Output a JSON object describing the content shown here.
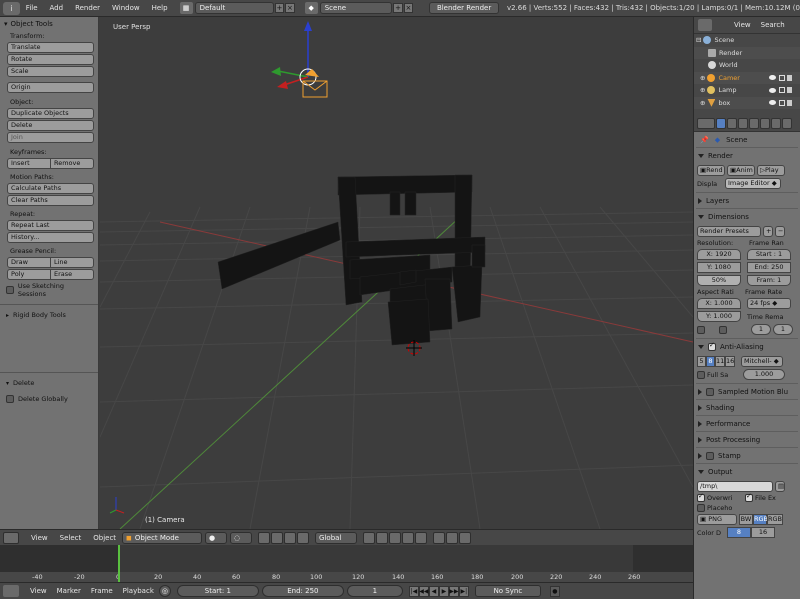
{
  "topbar": {
    "menus": [
      "File",
      "Add",
      "Render",
      "Window",
      "Help"
    ],
    "layout": "Default",
    "scene": "Scene",
    "engine": "Blender Render",
    "stats": "v2.66 | Verts:552 | Faces:432 | Tris:432 | Objects:1/20 | Lamps:0/1 | Mem:10.12M (0"
  },
  "toolshelf": {
    "title": "Object Tools",
    "transform_label": "Transform:",
    "translate": "Translate",
    "rotate": "Rotate",
    "scale": "Scale",
    "origin": "Origin",
    "object_label": "Object:",
    "duplicate": "Duplicate Objects",
    "delete": "Delete",
    "join": "Join",
    "keyframes_label": "Keyframes:",
    "insert": "Insert",
    "remove": "Remove",
    "motion_label": "Motion Paths:",
    "calc_paths": "Calculate Paths",
    "clear_paths": "Clear Paths",
    "repeat_label": "Repeat:",
    "repeat_last": "Repeat Last",
    "history": "History...",
    "grease_label": "Grease Pencil:",
    "draw": "Draw",
    "line": "Line",
    "poly": "Poly",
    "erase": "Erase",
    "sketching": "Use Sketching Sessions",
    "rigid": "Rigid Body Tools",
    "op_title": "Delete",
    "delete_globally": "Delete Globally"
  },
  "viewport": {
    "label": "User Persp",
    "object": "(1) Camera"
  },
  "viewheader": {
    "menus": [
      "View",
      "Select",
      "Object"
    ],
    "mode": "Object Mode",
    "orientation": "Global"
  },
  "timeline": {
    "ruler": [
      "-40",
      "-20",
      "0",
      "20",
      "40",
      "60",
      "80",
      "100",
      "120",
      "140",
      "160",
      "180",
      "200",
      "220",
      "240",
      "260"
    ],
    "menus": [
      "View",
      "Marker",
      "Frame",
      "Playback"
    ],
    "start": "Start: 1",
    "end": "End: 250",
    "current": "1",
    "sync": "No Sync"
  },
  "outliner": {
    "menus": [
      "View",
      "Search"
    ],
    "rows": [
      "Scene",
      "Render",
      "World",
      "Camer",
      "Lamp",
      "box"
    ]
  },
  "properties": {
    "crumb": "Scene",
    "render_panel": "Render",
    "render_btn": "Rend",
    "anim_btn": "Anim",
    "play_btn": "Play",
    "display_label": "Displa",
    "display_value": "Image Editor",
    "layers": "Layers",
    "dimensions": "Dimensions",
    "presets": "Render Presets",
    "resolution": "Resolution:",
    "frame_range": "Frame Ran",
    "res_x": "1920",
    "res_y": "1080",
    "res_pct": "50%",
    "start": "Start : 1",
    "end": "End: 250",
    "frame": "Fram: 1",
    "aspect": "Aspect Rati",
    "frame_rate": "Frame Rate",
    "asp_x": "1.000",
    "asp_y": "1.000",
    "fps": "24 fps",
    "time_rem": "Time Rema",
    "time_a": "1",
    "time_b": "1",
    "aa": "Anti-Aliasing",
    "aa_samples": [
      "5",
      "8",
      "11",
      "16"
    ],
    "aa_filter": "Mitchell-",
    "full_sample": "Full Sa",
    "filter_size": "1.000",
    "sampled_mb": "Sampled Motion Blu",
    "shading": "Shading",
    "performance": "Performance",
    "post": "Post Processing",
    "stamp": "Stamp",
    "output": "Output",
    "path": "/tmp\\",
    "overwrite": "Overwri",
    "file_ext": "File Ex",
    "placeholders": "Placeho",
    "format": "PNG",
    "bw": "BW",
    "rgb": "RGB",
    "rgba": "RGB",
    "color_depth": "Color D",
    "depth_8": "8",
    "depth_16": "16"
  }
}
